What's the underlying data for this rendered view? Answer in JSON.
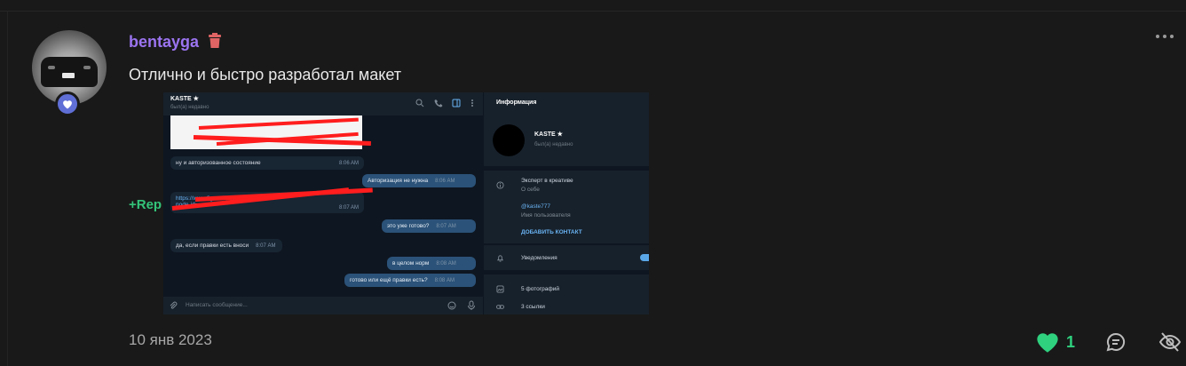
{
  "post": {
    "username": "bentayga",
    "message": "Отлично и быстро разработал макет",
    "rep_label": "+Rep",
    "date": "10 янв 2023",
    "likes": "1"
  },
  "colors": {
    "username": "#9b74f0",
    "accent": "#2fd17f",
    "rep": "#33c47a",
    "badge": "#5f6fd6"
  },
  "screenshot": {
    "chat": {
      "name": "KASTE ★",
      "status": "был(а) недавно",
      "composer_placeholder": "Написать сообщение...",
      "messages": [
        {
          "dir": "in",
          "text": "ну и авторизованное состояние",
          "time": "8:06 AM"
        },
        {
          "dir": "out",
          "text": "Авторизация не нужна",
          "time": "8:06 AM"
        },
        {
          "dir": "in",
          "text": "https://www.figma.com/file/...",
          "text2": "node-id=",
          "time": "8:07 AM"
        },
        {
          "dir": "out",
          "text": "это уже готово?",
          "time": "8:07 AM"
        },
        {
          "dir": "in",
          "text": "да, если правки есть вноси",
          "time": "8:07 AM"
        },
        {
          "dir": "out",
          "text": "в целом норм",
          "time": "8:08 AM"
        },
        {
          "dir": "out",
          "text": "готово или ещё правки есть?",
          "time": "8:08 AM"
        }
      ]
    },
    "info": {
      "title": "Информация",
      "name": "KASTE ★",
      "status": "был(а) недавно",
      "about": "Эксперт в креативе",
      "about_label": "О себе",
      "username": "@kaste777",
      "username_label": "Имя пользователя",
      "add_contact": "ДОБАВИТЬ КОНТАКТ",
      "notifications": "Уведомления",
      "photos": "5 фотографий",
      "links": "3 ссылки"
    }
  }
}
